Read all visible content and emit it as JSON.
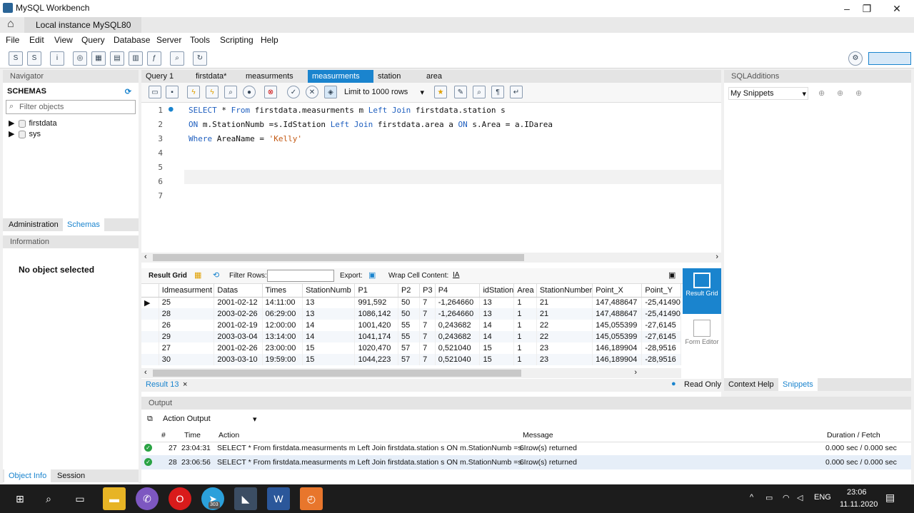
{
  "window": {
    "title": "MySQL Workbench",
    "min": "–",
    "max": "❐",
    "close": "✕"
  },
  "conn_tab": {
    "label": "Local instance MySQL80",
    "close": "×"
  },
  "menu": [
    "File",
    "Edit",
    "View",
    "Query",
    "Database",
    "Server",
    "Tools",
    "Scripting",
    "Help"
  ],
  "navigator": {
    "title": "Navigator",
    "schemas_label": "SCHEMAS",
    "filter_placeholder": "Filter objects",
    "schemas": [
      "firstdata",
      "sys"
    ],
    "tabs": [
      "Administration",
      "Schemas"
    ],
    "info_title": "Information",
    "no_object": "No object selected",
    "bottom_tabs": [
      "Object Info",
      "Session"
    ]
  },
  "query_tabs": [
    "Query 1",
    "firstdata*",
    "measurments",
    "measurments",
    "station",
    "area"
  ],
  "query_toolbar": {
    "limit": "Limit to 1000 rows"
  },
  "editor": {
    "line_numbers": [
      "1",
      "2",
      "3",
      "4",
      "5",
      "6",
      "7"
    ],
    "line1": {
      "k1": "SELECT",
      "t1": " * ",
      "k2": "From",
      "t2": " firstdata.measurments m ",
      "k3": "Left Join",
      "t3": " firstdata.station s"
    },
    "line2": {
      "k1": "ON",
      "t1": " m.StationNumb =s.IdStation ",
      "k2": "Left Join",
      "t2": " firstdata.area a ",
      "k3": "ON",
      "t3": " s.Area = a.IDarea"
    },
    "line3": {
      "k1": "Where",
      "t1": " AreaName = ",
      "s1": "'Kelly'"
    }
  },
  "result_toolbar": {
    "result_grid": "Result Grid",
    "filter_rows": "Filter Rows:",
    "export": "Export:",
    "wrap": "Wrap Cell Content:"
  },
  "grid": {
    "columns": [
      "Idmeasurment",
      "Datas",
      "Times",
      "StationNumb",
      "P1",
      "P2",
      "P3",
      "P4",
      "idStation",
      "Area",
      "StationNumber",
      "Point_X",
      "Point_Y"
    ],
    "rows": [
      [
        "25",
        "2001-02-12",
        "14:11:00",
        "13",
        "991,592",
        "50",
        "7",
        "-1,264660",
        "13",
        "1",
        "21",
        "147,488647",
        "-25,41490"
      ],
      [
        "28",
        "2003-02-26",
        "06:29:00",
        "13",
        "1086,142",
        "50",
        "7",
        "-1,264660",
        "13",
        "1",
        "21",
        "147,488647",
        "-25,41490"
      ],
      [
        "26",
        "2001-02-19",
        "12:00:00",
        "14",
        "1001,420",
        "55",
        "7",
        "0,243682",
        "14",
        "1",
        "22",
        "145,055399",
        "-27,6145"
      ],
      [
        "29",
        "2003-03-04",
        "13:14:00",
        "14",
        "1041,174",
        "55",
        "7",
        "0,243682",
        "14",
        "1",
        "22",
        "145,055399",
        "-27,6145"
      ],
      [
        "27",
        "2001-02-26",
        "23:00:00",
        "15",
        "1020,470",
        "57",
        "7",
        "0,521040",
        "15",
        "1",
        "23",
        "146,189904",
        "-28,9516"
      ],
      [
        "30",
        "2003-03-10",
        "19:59:00",
        "15",
        "1044,223",
        "57",
        "7",
        "0,521040",
        "15",
        "1",
        "23",
        "146,189904",
        "-28,9516"
      ]
    ]
  },
  "side": {
    "result_grid": "Result Grid",
    "form_editor": "Form Editor"
  },
  "result_tab": {
    "label": "Result 13",
    "close": "×",
    "readonly": "Read Only"
  },
  "sql_additions": {
    "title": "SQLAdditions",
    "snippets_select": "My Snippets",
    "tabs": [
      "Context Help",
      "Snippets"
    ]
  },
  "output": {
    "title": "Output",
    "select": "Action Output",
    "headers": [
      "#",
      "Time",
      "Action",
      "Message",
      "Duration / Fetch"
    ],
    "rows": [
      {
        "n": "27",
        "time": "23:04:31",
        "action": "SELECT * From firstdata.measurments m Left Join firstdata.station s  ON m.StationNumb =s.I...",
        "message": "6 row(s) returned",
        "duration": "0.000 sec / 0.000 sec"
      },
      {
        "n": "28",
        "time": "23:06:56",
        "action": "SELECT * From firstdata.measurments m Left Join firstdata.station s  ON m.StationNumb =s.I...",
        "message": "6 row(s) returned",
        "duration": "0.000 sec / 0.000 sec"
      }
    ]
  },
  "taskbar": {
    "time": "23:06",
    "date": "11.11.2020",
    "lang": "ENG",
    "telegram_badge": "303",
    "notif": "3"
  }
}
